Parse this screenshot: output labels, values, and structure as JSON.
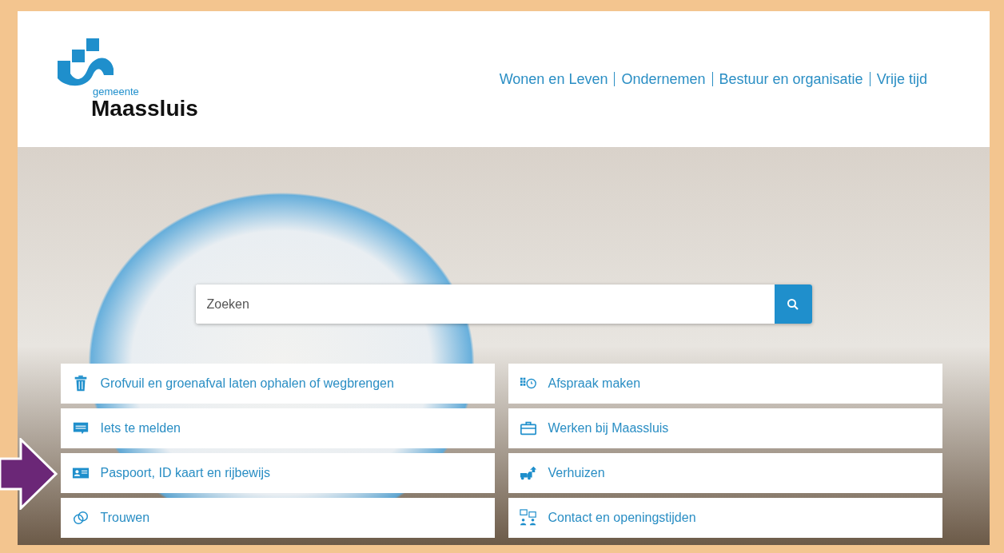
{
  "logo": {
    "small": "gemeente",
    "large": "Maassluis"
  },
  "nav": [
    "Wonen en Leven",
    "Ondernemen",
    "Bestuur en organisatie",
    "Vrije tijd"
  ],
  "search": {
    "placeholder": "Zoeken"
  },
  "tiles": [
    {
      "label": "Grofvuil en groenafval laten ophalen of wegbrengen",
      "kind": "trash"
    },
    {
      "label": "Afspraak maken",
      "kind": "calendar"
    },
    {
      "label": "Iets te melden",
      "kind": "chat"
    },
    {
      "label": "Werken bij Maassluis",
      "kind": "briefcase"
    },
    {
      "label": "Paspoort, ID kaart en rijbewijs",
      "kind": "idcard"
    },
    {
      "label": "Verhuizen",
      "kind": "truck"
    },
    {
      "label": "Trouwen",
      "kind": "rings"
    },
    {
      "label": "Contact en openingstijden",
      "kind": "people"
    }
  ]
}
